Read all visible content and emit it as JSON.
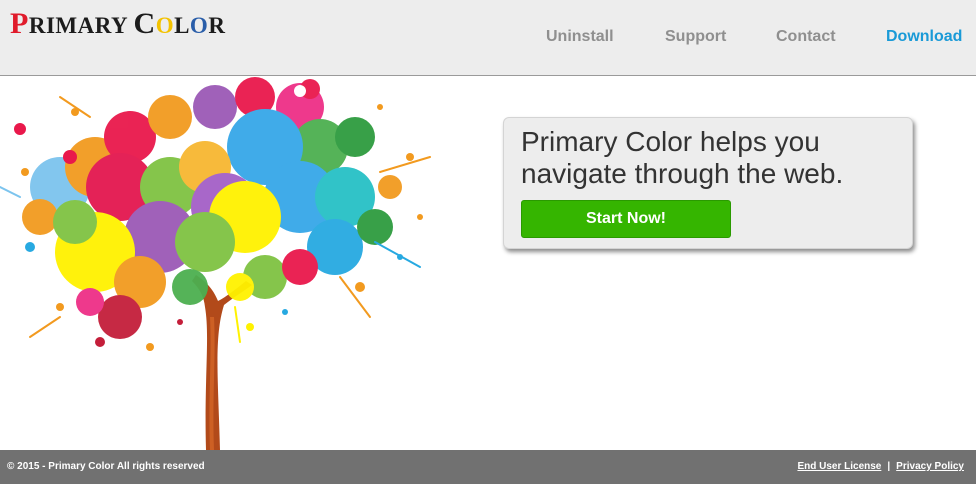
{
  "logo": {
    "letters": [
      {
        "text": "P",
        "size": "big",
        "color": "#e01b2b"
      },
      {
        "text": "RIMARY ",
        "size": "small",
        "color": "#1c1c1c"
      },
      {
        "text": "C",
        "size": "big",
        "color": "#1c1c1c"
      },
      {
        "text": "O",
        "size": "small",
        "color": "#f3c200"
      },
      {
        "text": "L",
        "size": "small",
        "color": "#1c1c1c"
      },
      {
        "text": "O",
        "size": "small",
        "color": "#2a5ea9"
      },
      {
        "text": "R",
        "size": "small",
        "color": "#1c1c1c"
      }
    ]
  },
  "nav": {
    "uninstall": "Uninstall",
    "support": "Support",
    "contact": "Contact",
    "download": "Download",
    "accent": "#1a9ad7"
  },
  "hero": {
    "image": "paint-splatter-tree"
  },
  "promo": {
    "title": "Primary Color helps you navigate through the web.",
    "button": "Start Now!",
    "button_color": "#35b500"
  },
  "footer": {
    "copyright": "© 2015 - Primary Color All rights reserved",
    "eula": "End User License",
    "separator": "|",
    "privacy": "Privacy Policy"
  }
}
